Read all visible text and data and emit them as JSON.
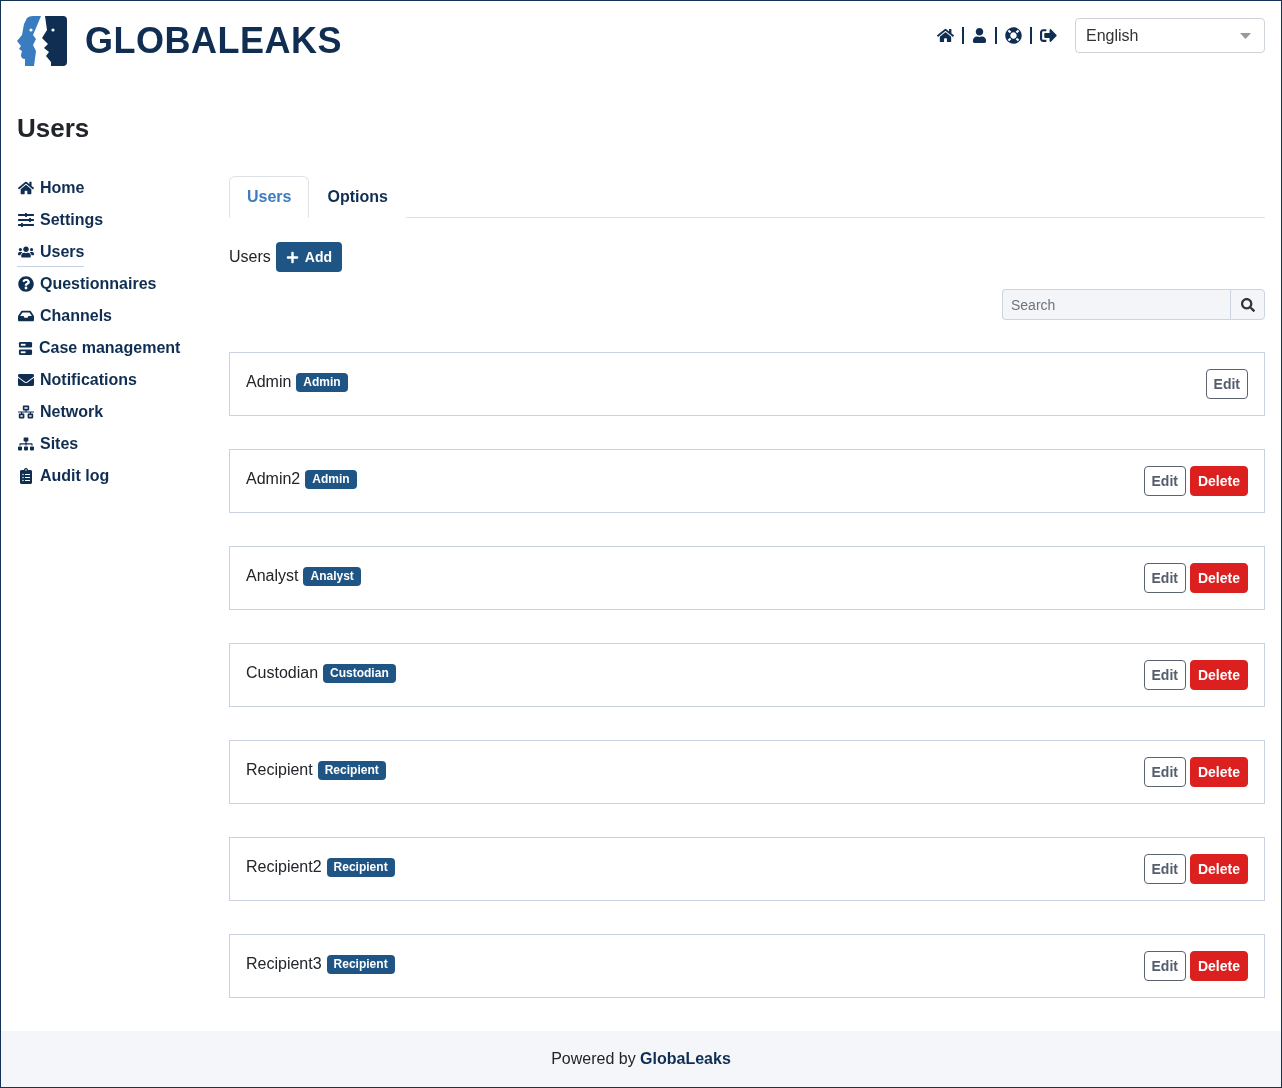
{
  "header": {
    "logo_text": "GLOBALEAKS",
    "language_select": {
      "value": "English"
    }
  },
  "page_title": "Users",
  "sidebar": {
    "items": [
      {
        "label": "Home",
        "selected": false
      },
      {
        "label": "Settings",
        "selected": false
      },
      {
        "label": "Users",
        "selected": true
      },
      {
        "label": "Questionnaires",
        "selected": false
      },
      {
        "label": "Channels",
        "selected": false
      },
      {
        "label": "Case management",
        "selected": false
      },
      {
        "label": "Notifications",
        "selected": false
      },
      {
        "label": "Network",
        "selected": false
      },
      {
        "label": "Sites",
        "selected": false
      },
      {
        "label": "Audit log",
        "selected": false
      }
    ]
  },
  "tabs": [
    {
      "label": "Users",
      "selected": true
    },
    {
      "label": "Options",
      "selected": false
    }
  ],
  "users_toolbar": {
    "label": "Users",
    "add_button": "Add"
  },
  "search": {
    "placeholder": "Search"
  },
  "users": [
    {
      "name": "Admin",
      "role": "Admin",
      "actions": [
        {
          "kind": "edit",
          "label": "Edit"
        }
      ]
    },
    {
      "name": "Admin2",
      "role": "Admin",
      "actions": [
        {
          "kind": "edit",
          "label": "Edit"
        },
        {
          "kind": "delete",
          "label": "Delete"
        }
      ]
    },
    {
      "name": "Analyst",
      "role": "Analyst",
      "actions": [
        {
          "kind": "edit",
          "label": "Edit"
        },
        {
          "kind": "delete",
          "label": "Delete"
        }
      ]
    },
    {
      "name": "Custodian",
      "role": "Custodian",
      "actions": [
        {
          "kind": "edit",
          "label": "Edit"
        },
        {
          "kind": "delete",
          "label": "Delete"
        }
      ]
    },
    {
      "name": "Recipient",
      "role": "Recipient",
      "actions": [
        {
          "kind": "edit",
          "label": "Edit"
        },
        {
          "kind": "delete",
          "label": "Delete"
        }
      ]
    },
    {
      "name": "Recipient2",
      "role": "Recipient",
      "actions": [
        {
          "kind": "edit",
          "label": "Edit"
        },
        {
          "kind": "delete",
          "label": "Delete"
        }
      ]
    },
    {
      "name": "Recipient3",
      "role": "Recipient",
      "actions": [
        {
          "kind": "edit",
          "label": "Edit"
        },
        {
          "kind": "delete",
          "label": "Delete"
        }
      ]
    }
  ],
  "footer": {
    "text": "Powered by **GlobaLeaks**"
  }
}
